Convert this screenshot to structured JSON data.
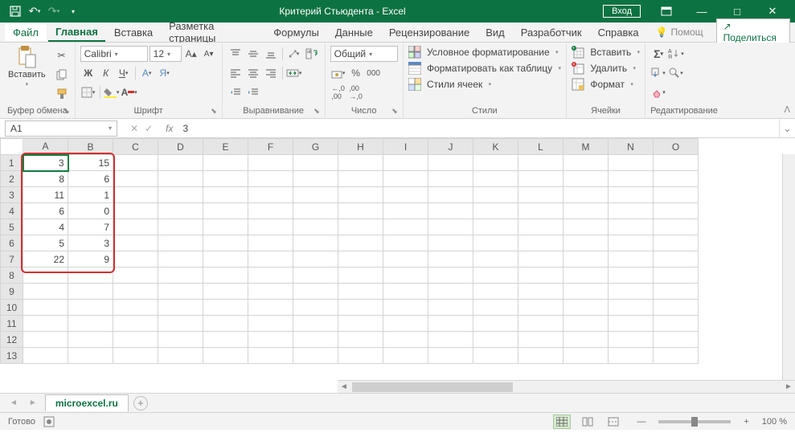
{
  "titlebar": {
    "title": "Критерий Стьюдента - Excel",
    "login": "Вход"
  },
  "menu": {
    "file": "Файл",
    "tabs": [
      "Главная",
      "Вставка",
      "Разметка страницы",
      "Формулы",
      "Данные",
      "Рецензирование",
      "Вид",
      "Разработчик",
      "Справка"
    ],
    "active": 0,
    "help_hint": "Помощ",
    "share": "Поделиться"
  },
  "ribbon": {
    "clipboard": {
      "label": "Буфер обмена",
      "paste": "Вставить"
    },
    "font": {
      "label": "Шрифт",
      "name": "Calibri",
      "size": "12",
      "bold": "Ж",
      "italic": "К",
      "underline": "Ч"
    },
    "align": {
      "label": "Выравнивание"
    },
    "number": {
      "label": "Число",
      "format": "Общий"
    },
    "styles": {
      "label": "Стили",
      "cond": "Условное форматирование",
      "table": "Форматировать как таблицу",
      "cell": "Стили ячеек"
    },
    "cells": {
      "label": "Ячейки",
      "insert": "Вставить",
      "delete": "Удалить",
      "format": "Формат"
    },
    "editing": {
      "label": "Редактирование"
    }
  },
  "formula": {
    "namebox": "A1",
    "value": "3"
  },
  "grid": {
    "cols": [
      "A",
      "B",
      "C",
      "D",
      "E",
      "F",
      "G",
      "H",
      "I",
      "J",
      "K",
      "L",
      "M",
      "N",
      "O"
    ],
    "rows": 13,
    "data": {
      "A": [
        "3",
        "8",
        "11",
        "6",
        "4",
        "5",
        "22"
      ],
      "B": [
        "15",
        "6",
        "1",
        "0",
        "7",
        "3",
        "9"
      ]
    },
    "active": {
      "r": 1,
      "c": "A"
    },
    "highlight": {
      "r1": 1,
      "c1": "A",
      "r2": 7,
      "c2": "B"
    }
  },
  "tabs": {
    "sheet": "microexcel.ru"
  },
  "status": {
    "ready": "Готово",
    "zoom": "100 %"
  }
}
